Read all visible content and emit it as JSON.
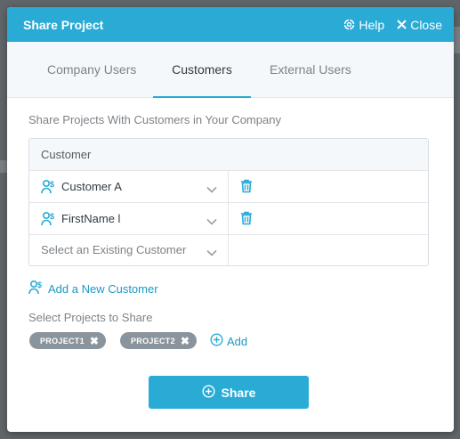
{
  "dialog": {
    "title": "Share Project",
    "help_label": "Help",
    "close_label": "Close"
  },
  "tabs": [
    {
      "label": "Company Users",
      "active": false
    },
    {
      "label": "Customers",
      "active": true
    },
    {
      "label": "External Users",
      "active": false
    }
  ],
  "customers_section": {
    "heading": "Share Projects With Customers in Your Company",
    "table_header": "Customer",
    "rows": [
      {
        "name": "Customer A"
      },
      {
        "name": "FirstName l"
      }
    ],
    "select_placeholder": "Select an Existing Customer",
    "add_new_label": "Add a New Customer"
  },
  "projects_section": {
    "heading": "Select Projects to Share",
    "chips": [
      "PROJECT1",
      "PROJECT2"
    ],
    "add_label": "Add"
  },
  "share_button_label": "Share",
  "colors": {
    "accent": "#29abd6",
    "link": "#1f97c2",
    "chip": "#8a949c"
  },
  "icons": {
    "help": "lifebuoy-icon",
    "close": "close-icon",
    "customer": "customer-icon",
    "delete": "trash-icon",
    "dropdown": "chevron-down-icon",
    "add": "plus-circle-icon"
  }
}
